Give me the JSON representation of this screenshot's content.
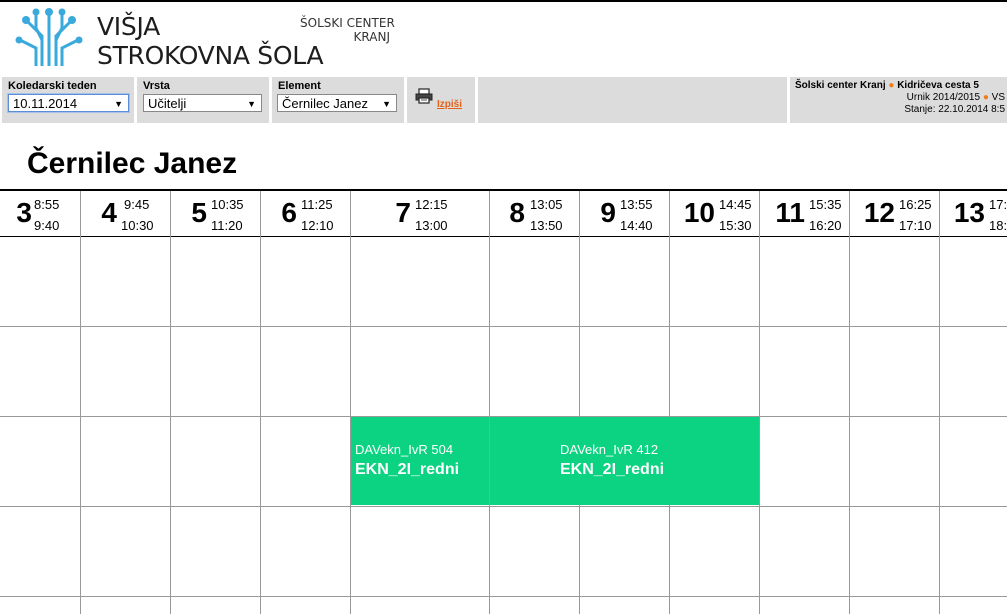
{
  "header": {
    "school_line1": "VIŠJA",
    "school_line2": "STROKOVNA ŠOLA",
    "center_line1": "ŠOLSKI CENTER",
    "center_line2": "KRANJ"
  },
  "toolbar": {
    "week_label": "Koledarski teden",
    "week_value": "10.11.2014",
    "type_label": "Vrsta",
    "type_value": "Učitelji",
    "element_label": "Element",
    "element_value": "Černilec Janez",
    "print_label": "Izpiši",
    "info_line1_a": "Šolski center Kranj",
    "info_line1_b": "Kidričeva cesta 5",
    "info_line2_a": "Urnik 2014/2015",
    "info_line2_b": "VS",
    "info_line3": "Stanje: 22.10.2014 8:5"
  },
  "page": {
    "title": "Černilec Janez"
  },
  "periods": [
    {
      "num": "3",
      "start": "8:55",
      "end": "9:40"
    },
    {
      "num": "4",
      "start": "9:45",
      "end": "10:30"
    },
    {
      "num": "5",
      "start": "10:35",
      "end": "11:20"
    },
    {
      "num": "6",
      "start": "11:25",
      "end": "12:10"
    },
    {
      "num": "7",
      "start": "12:15",
      "end": "13:00"
    },
    {
      "num": "8",
      "start": "13:05",
      "end": "13:50"
    },
    {
      "num": "9",
      "start": "13:55",
      "end": "14:40"
    },
    {
      "num": "10",
      "start": "14:45",
      "end": "15:30"
    },
    {
      "num": "11",
      "start": "15:35",
      "end": "16:20"
    },
    {
      "num": "12",
      "start": "16:25",
      "end": "17:10"
    },
    {
      "num": "13",
      "start": "17:",
      "end": "18:"
    }
  ],
  "lessons": [
    {
      "subject": "DAVekn_IvR",
      "room": "504",
      "group": "EKN_2I_redni"
    },
    {
      "subject": "DAVekn_IvR",
      "room": "412",
      "group": "EKN_2I_redni"
    }
  ],
  "colors": {
    "lesson": "#0bd381",
    "accent": "#e2621a",
    "dot": "#f07d1c",
    "toolbar": "#dcdcdc"
  }
}
